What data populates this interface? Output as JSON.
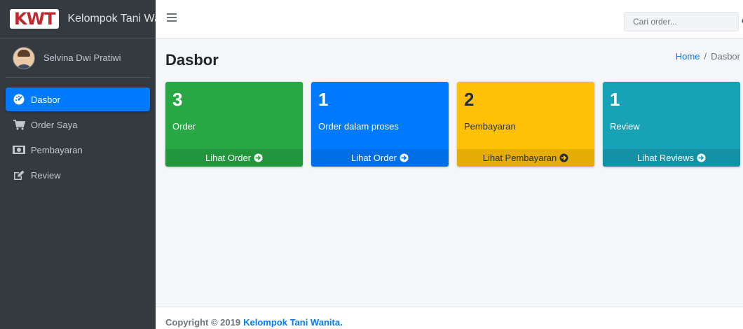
{
  "brand": {
    "logo_text": "KWT",
    "name": "Kelompok Tani Wanita"
  },
  "user": {
    "name": "Selvina Dwi Pratiwi"
  },
  "sidebar": {
    "items": [
      {
        "label": "Dasbor",
        "icon": "dashboard-icon",
        "active": true
      },
      {
        "label": "Order Saya",
        "icon": "cart-icon",
        "active": false
      },
      {
        "label": "Pembayaran",
        "icon": "money-icon",
        "active": false
      },
      {
        "label": "Review",
        "icon": "edit-icon",
        "active": false
      }
    ]
  },
  "search": {
    "placeholder": "Cari order...",
    "value": ""
  },
  "page": {
    "title": "Dasbor",
    "breadcrumb": {
      "home": "Home",
      "separator": "/",
      "current": "Dasbor"
    }
  },
  "cards": [
    {
      "count": "3",
      "label": "Order",
      "link": "Lihat Order",
      "color": "#28a745"
    },
    {
      "count": "1",
      "label": "Order dalam proses",
      "link": "Lihat Order",
      "color": "#007bff"
    },
    {
      "count": "2",
      "label": "Pembayaran",
      "link": "Lihat Pembayaran",
      "color": "#ffc107"
    },
    {
      "count": "1",
      "label": "Review",
      "link": "Lihat Reviews",
      "color": "#17a2b8"
    }
  ],
  "footer": {
    "copyright": "Copyright © 2019",
    "org": "Kelompok Tani Wanita."
  }
}
